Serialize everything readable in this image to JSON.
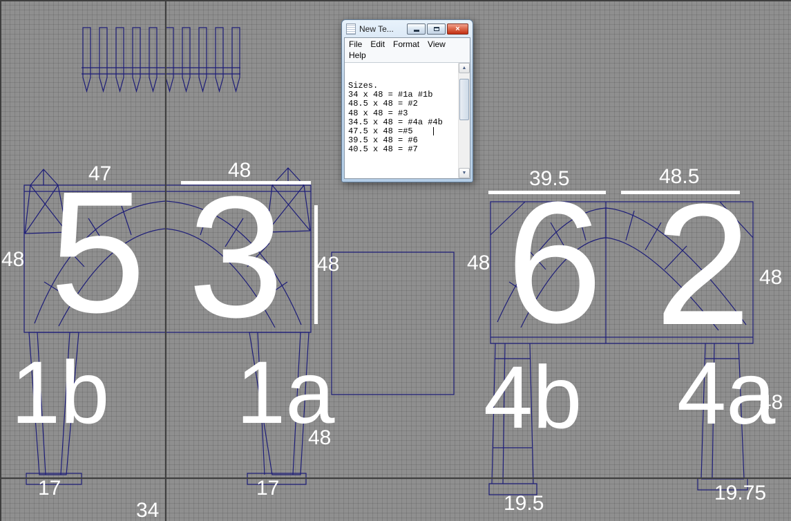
{
  "notepad": {
    "title": "New Te...",
    "menu": [
      "File",
      "Edit",
      "Format",
      "View",
      "Help"
    ],
    "lines": [
      "Sizes.",
      "34 x 48 = #1a #1b",
      "48.5 x 48 = #2",
      "48 x 48 = #3",
      "34.5 x 48 = #4a #4b",
      "47.5 x 48 =#5",
      "39.5 x 48 = #6",
      "40.5 x 48 = #7"
    ],
    "scroll_up_glyph": "▲",
    "scroll_down_glyph": "▼",
    "close_glyph": "×"
  },
  "pieces": {
    "n5": "5",
    "n3": "3",
    "n6": "6",
    "n2": "2",
    "n1b": "1b",
    "n1a": "1a",
    "n4b": "4b",
    "n4a": "4a"
  },
  "dims": {
    "top_47": "47",
    "top_48": "48",
    "top_39_5": "39.5",
    "top_48_5": "48.5",
    "left_48": "48",
    "right_of_3_48": "48",
    "left_of_6_48": "48",
    "right_upper_48": "48",
    "below_mid_48": "48",
    "right_lower_48": "48",
    "bottom_17_left": "17",
    "bottom_17_mid": "17",
    "bottom_34": "34",
    "bottom_19_5": "19.5",
    "bottom_19_75": "19.75"
  },
  "colors": {
    "viewport_background": "#8f8f8f",
    "wireframe": "#1d1d78",
    "dimension_text": "#ffffff",
    "axis_line": "#3e3e3e",
    "close_button": "#c22f13"
  }
}
